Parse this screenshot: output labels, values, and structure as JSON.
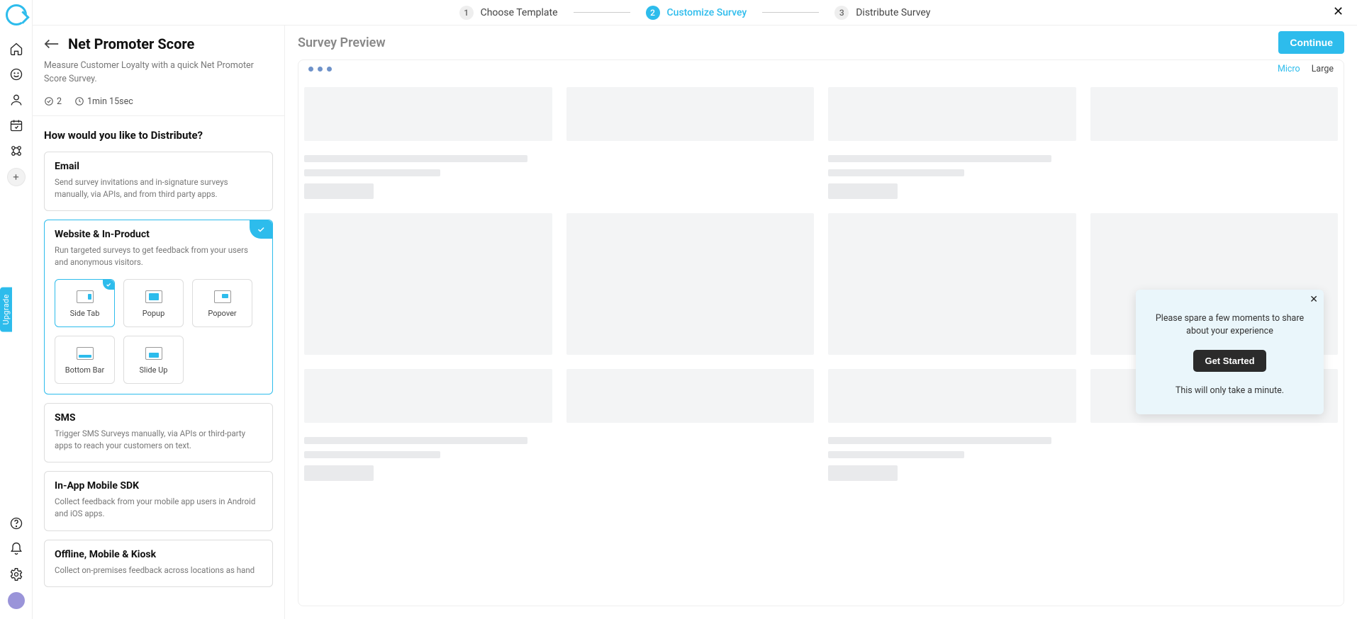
{
  "wizard": {
    "steps": [
      "Choose Template",
      "Customize Survey",
      "Distribute Survey"
    ],
    "active_index": 1
  },
  "upgrade_label": "Upgrade",
  "config": {
    "title": "Net Promoter Score",
    "subtitle": "Measure Customer Loyalty with a quick Net Promoter Score Survey.",
    "question_count": "2",
    "duration": "1min 15sec",
    "distribute_title": "How would you like to Distribute?",
    "cards": {
      "email": {
        "title": "Email",
        "desc": "Send survey invitations and in-signature surveys manually, via APIs, and from third party apps."
      },
      "web": {
        "title": "Website & In-Product",
        "desc": "Run targeted surveys to get feedback from your users and anonymous visitors.",
        "widgets": [
          "Side Tab",
          "Popup",
          "Popover",
          "Bottom Bar",
          "Slide Up"
        ]
      },
      "sms": {
        "title": "SMS",
        "desc": "Trigger SMS Surveys manually, via APIs or third-party apps to reach your customers on text."
      },
      "sdk": {
        "title": "In-App Mobile SDK",
        "desc": "Collect feedback from your mobile app users in Android and iOS apps."
      },
      "kiosk": {
        "title": "Offline, Mobile & Kiosk",
        "desc": "Collect on-premises feedback across locations as hand"
      }
    }
  },
  "preview": {
    "title": "Survey Preview",
    "continue": "Continue",
    "sizes": {
      "micro": "Micro",
      "large": "Large"
    },
    "invite": {
      "line1": "Please spare a few moments to share about your experience",
      "button": "Get Started",
      "line2": "This will only take a minute."
    }
  }
}
